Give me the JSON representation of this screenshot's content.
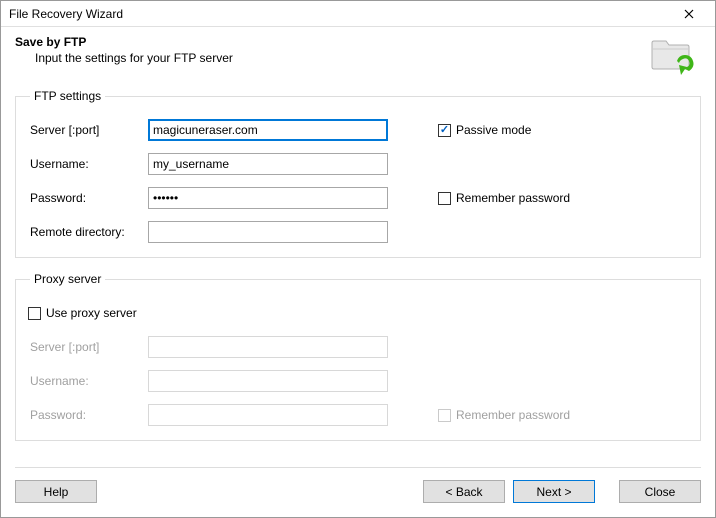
{
  "window": {
    "title": "File Recovery Wizard"
  },
  "header": {
    "title": "Save by FTP",
    "subtitle": "Input the settings for your FTP server"
  },
  "ftp": {
    "legend": "FTP settings",
    "server_label": "Server [:port]",
    "server_value": "magicuneraser.com",
    "username_label": "Username:",
    "username_value": "my_username",
    "password_label": "Password:",
    "password_value": "rrrrrr",
    "remote_label": "Remote directory:",
    "remote_value": "",
    "passive_label": "Passive mode",
    "remember_label": "Remember password"
  },
  "proxy": {
    "legend": "Proxy server",
    "use_label": "Use proxy server",
    "server_label": "Server [:port]",
    "server_value": "",
    "username_label": "Username:",
    "username_value": "",
    "password_label": "Password:",
    "password_value": "",
    "remember_label": "Remember password"
  },
  "buttons": {
    "help": "Help",
    "back": "< Back",
    "next": "Next >",
    "close": "Close"
  }
}
